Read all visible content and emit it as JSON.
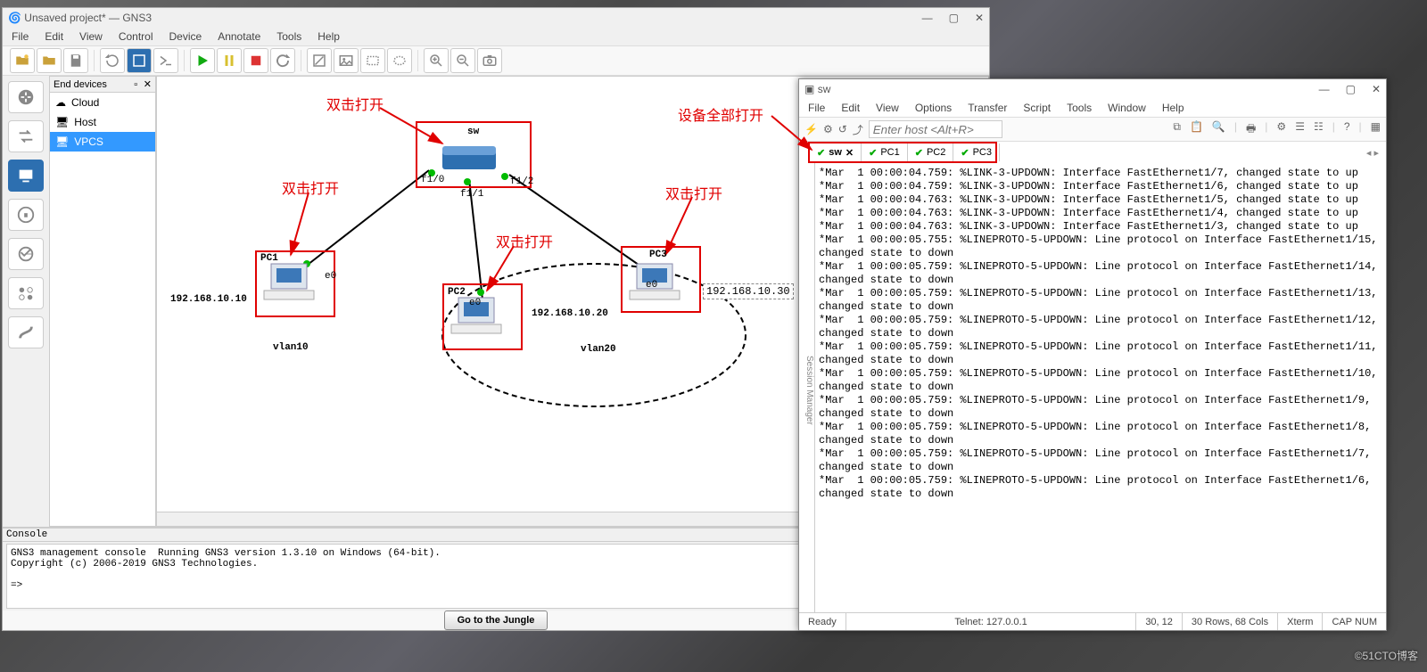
{
  "watermark": "©51CTO博客",
  "gns3": {
    "app_icon": "🌀",
    "title": "Unsaved project* — GNS3",
    "menu": [
      "File",
      "Edit",
      "View",
      "Control",
      "Device",
      "Annotate",
      "Tools",
      "Help"
    ],
    "devices_panel": {
      "title": "End devices",
      "items": [
        "Cloud",
        "Host",
        "VPCS"
      ],
      "selected": 2
    },
    "annotations": {
      "a1": "双击打开",
      "a2": "双击打开",
      "a3": "双击打开",
      "a4": "双击打开",
      "dev_all_open": "设备全部打开"
    },
    "nodes": {
      "sw": "sw",
      "sw_p0": "f1/0",
      "sw_p1": "f1/1",
      "sw_p2": "f1/2",
      "pc1": "PC1",
      "pc1_e": "e0",
      "pc1_ip": "192.168.10.10",
      "pc2": "PC2",
      "pc2_e": "e0",
      "pc2_ip": "192.168.10.20",
      "pc3": "PC3",
      "pc3_e": "e0",
      "pc3_ip": "192.168.10.30",
      "vlan10": "vlan10",
      "vlan20": "vlan20"
    },
    "console": {
      "title": "Console",
      "body": "GNS3 management console  Running GNS3 version 1.3.10 on Windows (64-bit).\nCopyright (c) 2006-2019 GNS3 Technologies.\n\n=>"
    },
    "jungle_btn": "Go to the Jungle"
  },
  "crt": {
    "title": "sw",
    "menu": [
      "File",
      "Edit",
      "View",
      "Options",
      "Transfer",
      "Script",
      "Tools",
      "Window",
      "Help"
    ],
    "host_placeholder": "Enter host <Alt+R>",
    "tabs": [
      {
        "label": "sw",
        "active": true,
        "closeable": true
      },
      {
        "label": "PC1",
        "active": false
      },
      {
        "label": "PC2",
        "active": false
      },
      {
        "label": "PC3",
        "active": false
      }
    ],
    "session_manager": "Session Manager",
    "terminal_lines": [
      "*Mar  1 00:00:04.759: %LINK-3-UPDOWN: Interface FastEthernet1/7, changed state to up",
      "*Mar  1 00:00:04.759: %LINK-3-UPDOWN: Interface FastEthernet1/6, changed state to up",
      "*Mar  1 00:00:04.763: %LINK-3-UPDOWN: Interface FastEthernet1/5, changed state to up",
      "*Mar  1 00:00:04.763: %LINK-3-UPDOWN: Interface FastEthernet1/4, changed state to up",
      "*Mar  1 00:00:04.763: %LINK-3-UPDOWN: Interface FastEthernet1/3, changed state to up",
      "*Mar  1 00:00:05.755: %LINEPROTO-5-UPDOWN: Line protocol on Interface FastEthernet1/15, changed state to down",
      "*Mar  1 00:00:05.759: %LINEPROTO-5-UPDOWN: Line protocol on Interface FastEthernet1/14, changed state to down",
      "*Mar  1 00:00:05.759: %LINEPROTO-5-UPDOWN: Line protocol on Interface FastEthernet1/13, changed state to down",
      "*Mar  1 00:00:05.759: %LINEPROTO-5-UPDOWN: Line protocol on Interface FastEthernet1/12, changed state to down",
      "*Mar  1 00:00:05.759: %LINEPROTO-5-UPDOWN: Line protocol on Interface FastEthernet1/11, changed state to down",
      "*Mar  1 00:00:05.759: %LINEPROTO-5-UPDOWN: Line protocol on Interface FastEthernet1/10, changed state to down",
      "*Mar  1 00:00:05.759: %LINEPROTO-5-UPDOWN: Line protocol on Interface FastEthernet1/9, changed state to down",
      "*Mar  1 00:00:05.759: %LINEPROTO-5-UPDOWN: Line protocol on Interface FastEthernet1/8, changed state to down",
      "*Mar  1 00:00:05.759: %LINEPROTO-5-UPDOWN: Line protocol on Interface FastEthernet1/7, changed state to down",
      "*Mar  1 00:00:05.759: %LINEPROTO-5-UPDOWN: Line protocol on Interface FastEthernet1/6, changed state to down"
    ],
    "status": {
      "s1": "Ready",
      "s2": "Telnet: 127.0.0.1",
      "s3": "30, 12",
      "s4": "30 Rows, 68 Cols",
      "s5": "Xterm",
      "s6": "CAP NUM"
    }
  }
}
